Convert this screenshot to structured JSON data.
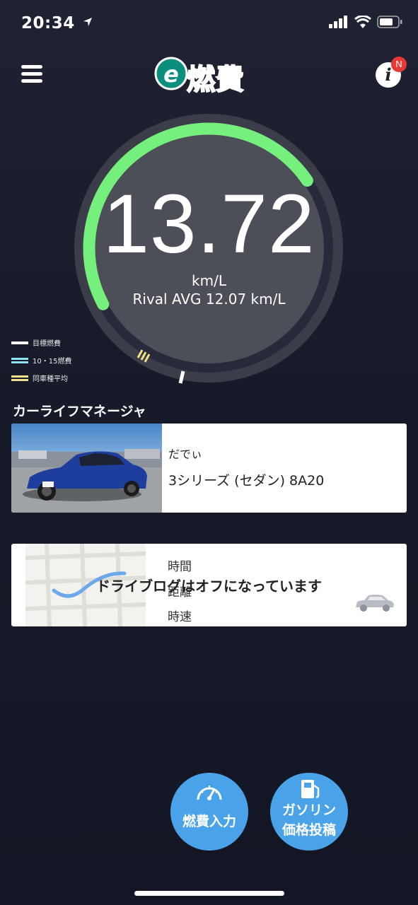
{
  "status_bar": {
    "time": "20:34"
  },
  "header": {
    "logo_text": "燃費",
    "info_badge": "N"
  },
  "gauge": {
    "value": "13.72",
    "unit": "km/L",
    "rival_avg": "Rival AVG 12.07 km/L",
    "progress_fraction": 0.62
  },
  "legend": [
    {
      "label": "目標燃費",
      "color": "#ffffff"
    },
    {
      "label": "10・15燃費",
      "color": "#8fe3f2"
    },
    {
      "label": "同車種平均",
      "color": "#f3e08a"
    }
  ],
  "section": {
    "title": "カーライフマネージャ"
  },
  "car_card": {
    "owner": "だでぃ",
    "model": "3シリーズ (セダン) 8A20"
  },
  "drive_log": {
    "time_label": "時間",
    "distance_label": "距離",
    "speed_label": "時速",
    "off_message": "ドライブログはオフになっています"
  },
  "buttons": {
    "fuel_input": "燃費入力",
    "gas_price_line1": "ガソリン",
    "gas_price_line2": "価格投稿"
  },
  "colors": {
    "accent_green": "#76f07c",
    "button_blue": "#4aa3e8"
  }
}
